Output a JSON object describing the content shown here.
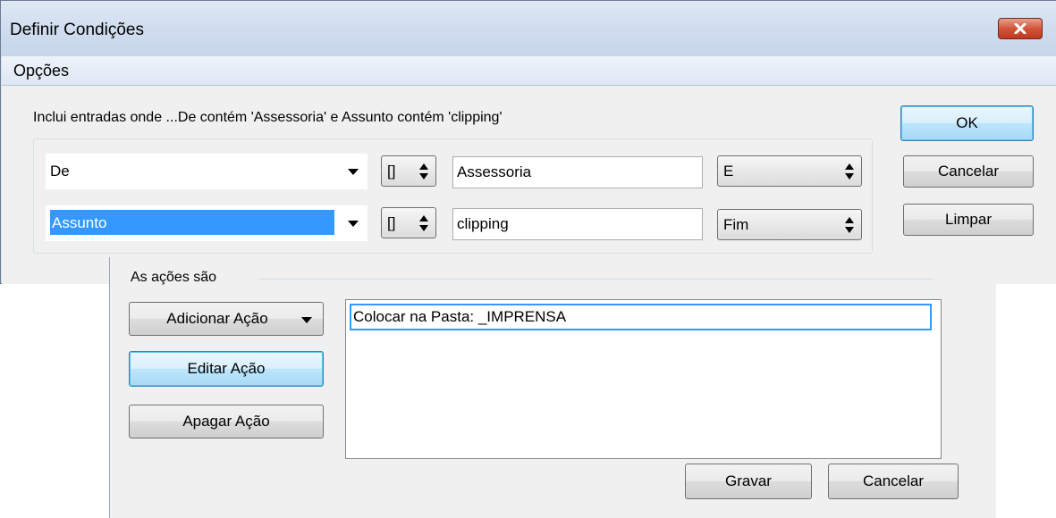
{
  "window": {
    "title": "Definir Condições"
  },
  "menu": {
    "options_label": "Opções"
  },
  "conditions": {
    "summary": "Inclui entradas onde ...De  contém 'Assessoria' e Assunto  contém 'clipping'",
    "rows": [
      {
        "field": "De",
        "operator": "[]",
        "value": "Assessoria",
        "connector": "E"
      },
      {
        "field": "Assunto",
        "operator": "[]",
        "value": "clipping",
        "connector": "Fim"
      }
    ]
  },
  "dialog_buttons": {
    "ok": "OK",
    "cancel": "Cancelar",
    "clear": "Limpar"
  },
  "actions": {
    "group_label": "As ações são",
    "add_action": "Adicionar Ação",
    "edit_action": "Editar Ação",
    "delete_action": "Apagar Ação",
    "list": [
      "Colocar na Pasta: _IMPRENSA"
    ],
    "save": "Gravar",
    "cancel": "Cancelar"
  },
  "colors": {
    "selection": "#3399ff",
    "focus_button": "#bee6fd",
    "close_button": "#c0391f"
  }
}
